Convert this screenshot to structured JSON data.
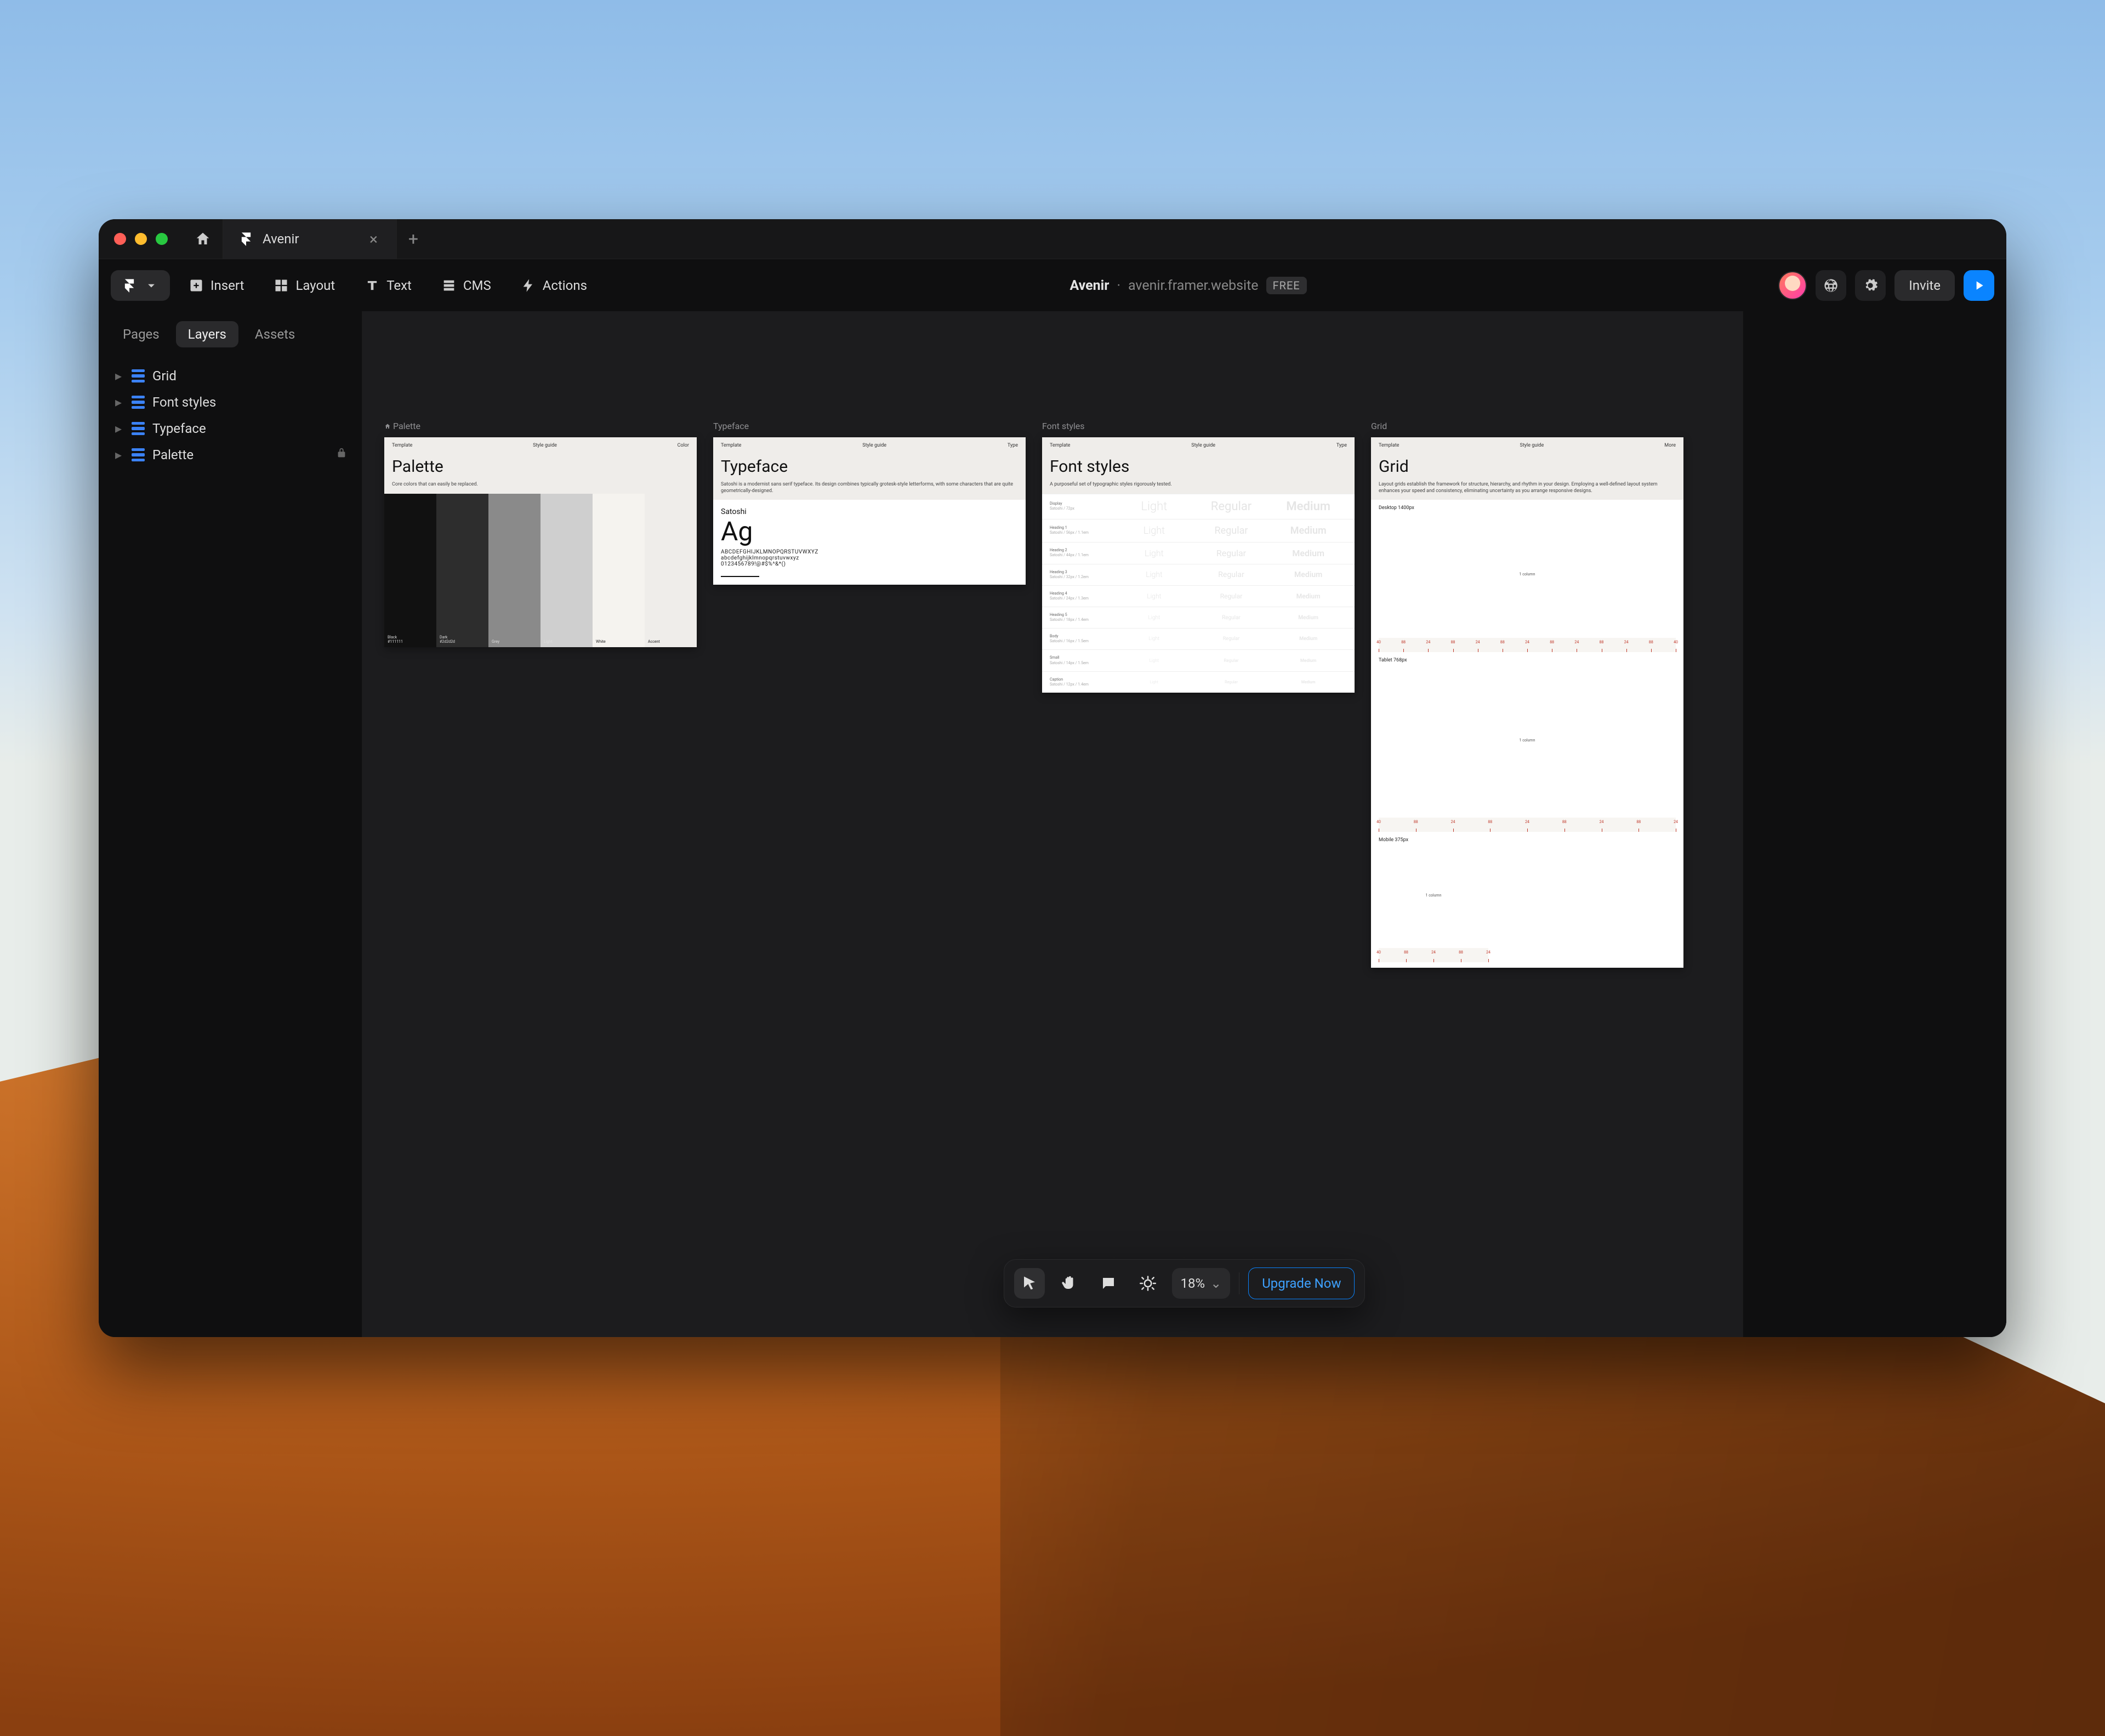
{
  "window": {
    "tab_title": "Avenir",
    "project_name": "Avenir",
    "project_url": "avenir.framer.website",
    "plan_badge": "FREE"
  },
  "toolbar": {
    "insert": "Insert",
    "layout": "Layout",
    "text": "Text",
    "cms": "CMS",
    "actions": "Actions",
    "invite": "Invite"
  },
  "sidebar": {
    "tabs": {
      "pages": "Pages",
      "layers": "Layers",
      "assets": "Assets"
    },
    "layers": [
      {
        "name": "Grid"
      },
      {
        "name": "Font styles"
      },
      {
        "name": "Typeface"
      },
      {
        "name": "Palette",
        "locked": true
      }
    ]
  },
  "canvas": {
    "framebar": {
      "col1": "Template",
      "col2": "Style guide",
      "col3": "Color",
      "col3b": "Type",
      "col3c": "Type",
      "col3d": "More"
    },
    "palette": {
      "label": "Palette",
      "title": "Palette",
      "subtitle": "Core colors that can easily be replaced.",
      "swatches": [
        {
          "name": "Black",
          "hex": "#111111",
          "caption": "Black\\n#111111"
        },
        {
          "name": "Dark",
          "hex": "#2d2d2d",
          "caption": "Dark\\n#2d2d2d"
        },
        {
          "name": "Grey",
          "hex": "#8a8a8a",
          "caption": "Grey"
        },
        {
          "name": "Light",
          "hex": "#cfcfcf",
          "caption": "Light"
        },
        {
          "name": "White",
          "hex": "#f5f3ef",
          "caption": "White",
          "dark_caption": true
        },
        {
          "name": "Accent",
          "hex": "#efedea",
          "caption": "Accent",
          "dark_caption": true
        }
      ]
    },
    "typeface": {
      "label": "Typeface",
      "title": "Typeface",
      "subtitle": "Satoshi is a modernist sans serif typeface. Its design combines typically grotesk-style letterforms, with some characters that are quite geometrically-designed.",
      "font_name": "Satoshi",
      "specimen": "Ag",
      "alpha1": "ABCDEFGHIJKLMNOPQRSTUVWXYZ",
      "alpha2": "abcdefghijklmnopqrstuvwxyz",
      "alpha3": "0123456789!@#$%^&*()"
    },
    "fontstyles": {
      "label": "Font styles",
      "title": "Font styles",
      "subtitle": "A purposeful set of typographic styles rigorously tested.",
      "weights": {
        "light": "Light",
        "regular": "Regular",
        "medium": "Medium"
      },
      "rows": [
        {
          "l1": "Display",
          "l2": "Satoshi / 72px",
          "size": 22
        },
        {
          "l1": "Heading 1",
          "l2": "Satoshi / 56px / 1.1em",
          "size": 18
        },
        {
          "l1": "Heading 2",
          "l2": "Satoshi / 44px / 1.1em",
          "size": 16
        },
        {
          "l1": "Heading 3",
          "l2": "Satoshi / 32px / 1.2em",
          "size": 14
        },
        {
          "l1": "Heading 4",
          "l2": "Satoshi / 24px / 1.3em",
          "size": 12
        },
        {
          "l1": "Heading 5",
          "l2": "Satoshi / 18px / 1.4em",
          "size": 10
        },
        {
          "l1": "Body",
          "l2": "Satoshi / 16px / 1.5em",
          "size": 9
        },
        {
          "l1": "Small",
          "l2": "Satoshi / 14px / 1.5em",
          "size": 8
        },
        {
          "l1": "Caption",
          "l2": "Satoshi / 12px / 1.4em",
          "size": 7
        }
      ]
    },
    "grid": {
      "label": "Grid",
      "title": "Grid",
      "subtitle": "Layout grids establish the framework for structure, hierarchy, and rhythm in your design. Employing a well-defined layout system enhances your speed and consistency, eliminating uncertainty as you arrange responsive designs.",
      "sections": {
        "desktop": "Desktop 1400px",
        "tablet": "Tablet 768px",
        "mobile": "Mobile 375px"
      },
      "center_label": "1 column",
      "ruler_values": [
        "40",
        "88",
        "24",
        "88",
        "24",
        "88",
        "24",
        "88",
        "24",
        "88",
        "24",
        "88",
        "40"
      ]
    }
  },
  "floatbar": {
    "zoom": "18%",
    "upgrade": "Upgrade Now"
  }
}
